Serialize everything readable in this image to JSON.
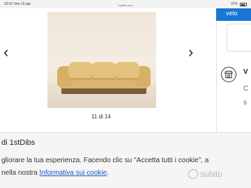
{
  "status_bar": {
    "time": "20:37",
    "date": "Ven 10 apr",
    "url": "1stdibs.com",
    "battery": "37%"
  },
  "gallery": {
    "image_alt": "sofa",
    "counter": "11 di 14",
    "prev_icon": "chevron-left-icon",
    "next_icon": "chevron-right-icon"
  },
  "side_panel": {
    "button_label": "velo",
    "store_icon": "store-icon",
    "store_title": "V",
    "store_line2": "C",
    "store_line3": "s"
  },
  "cookie_banner": {
    "title": "di 1stDibs",
    "line1": "gliorare la tua esperienza. Facendo clic su \"Accetta tutti i cookie\", a",
    "line2_prefix": "nella nostra ",
    "policy_link": "Informativa sui cookie",
    "line2_suffix": "."
  },
  "watermark": {
    "text": "subito"
  }
}
